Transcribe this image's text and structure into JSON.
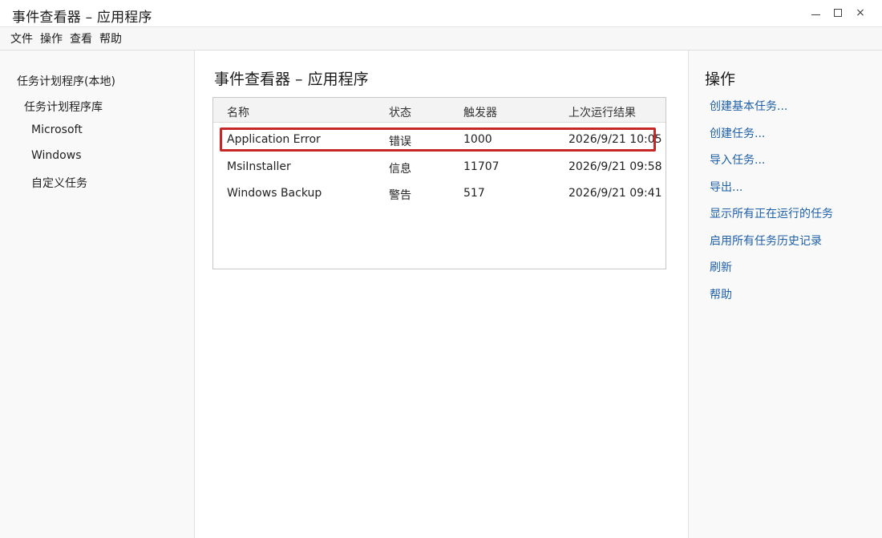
{
  "window": {
    "title": "事件查看器 – 应用程序",
    "controls": {
      "minimize": "",
      "maximize": "",
      "close": "×"
    }
  },
  "menu": [
    "文件",
    "操作",
    "查看",
    "帮助"
  ],
  "nav": {
    "items": [
      {
        "label": "任务计划程序(本地)"
      },
      {
        "label": "任务计划程序库"
      },
      {
        "label": "Microsoft"
      },
      {
        "label": "Windows"
      },
      {
        "label": "自定义任务"
      }
    ]
  },
  "main": {
    "title": "事件查看器 – 应用程序",
    "columns": [
      "名称",
      "状态",
      "触发器",
      "上次运行结果"
    ],
    "rows": [
      {
        "name": "Application Error",
        "status": "错误",
        "trigger": "1000",
        "last_run": "2026/9/21 10:05"
      },
      {
        "name": "MsiInstaller",
        "status": "信息",
        "trigger": "11707",
        "last_run": "2026/9/21 09:58"
      },
      {
        "name": "Windows Backup",
        "status": "警告",
        "trigger": "517",
        "last_run": "2026/9/21 09:41"
      }
    ],
    "highlight_color": "#c62828"
  },
  "actions": {
    "title": "操作",
    "items": [
      "创建基本任务...",
      "创建任务...",
      "导入任务...",
      "导出...",
      "显示所有正在运行的任务",
      "启用所有任务历史记录",
      "刷新",
      "帮助"
    ],
    "link_color": "#1d5fa8"
  }
}
